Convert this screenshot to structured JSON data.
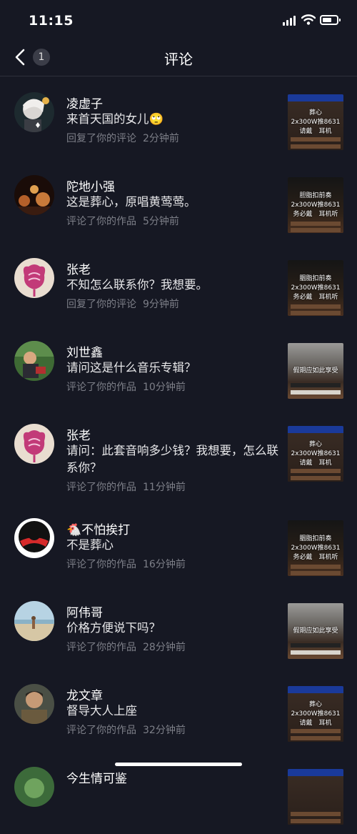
{
  "status": {
    "time": "11:15"
  },
  "nav": {
    "back_icon": "chevron-left-icon",
    "count": "1",
    "title": "评论"
  },
  "items": [
    {
      "name": "凌虚子",
      "comment": "来首天国的女儿🙄",
      "action": "回复了你的评论",
      "time": "2分钟前",
      "avatar": "anime-avatar",
      "thumb": {
        "lines": [
          "葬心",
          "2x300W推8631",
          "请戴　耳机"
        ],
        "style": "blue"
      }
    },
    {
      "name": "陀地小强",
      "comment": "这是葬心，原唱黄莺莺。",
      "action": "评论了你的作品",
      "time": "5分钟前",
      "avatar": "band-avatar",
      "thumb": {
        "lines": [
          "胆脂扣前奏",
          "2x300W推8631",
          "务必戴　耳机听"
        ],
        "style": "dark"
      }
    },
    {
      "name": "张老",
      "comment": "不知怎么联系你？我想要。",
      "action": "回复了你的评论",
      "time": "9分钟前",
      "avatar": "flower-avatar",
      "thumb": {
        "lines": [
          "胭脂扣前奏",
          "2x300W推8631",
          "务必戴　耳机听"
        ],
        "style": "dark"
      }
    },
    {
      "name": "刘世鑫",
      "comment": "请问这是什么音乐专辑？",
      "action": "评论了你的作品",
      "time": "10分钟前",
      "avatar": "child-avatar",
      "thumb": {
        "lines": [
          "假期应如此享受"
        ],
        "style": "room"
      }
    },
    {
      "name": "张老",
      "comment": "请问：此套音响多少钱？我想要，怎么联系你？",
      "action": "评论了你的作品",
      "time": "11分钟前",
      "avatar": "flower-avatar",
      "thumb": {
        "lines": [
          "葬心",
          "2x300W推8631",
          "请戴　耳机"
        ],
        "style": "blue"
      }
    },
    {
      "name": "🐔不怕挨打",
      "comment": "不是葬心",
      "action": "评论了你的作品",
      "time": "16分钟前",
      "avatar": "hero-avatar",
      "thumb": {
        "lines": [
          "胭脂扣前奏",
          "2x300W推8631",
          "务必戴　耳机听"
        ],
        "style": "dark"
      }
    },
    {
      "name": "阿伟哥",
      "comment": "价格方便说下吗？",
      "action": "评论了你的作品",
      "time": "28分钟前",
      "avatar": "beach-avatar",
      "thumb": {
        "lines": [
          "假期应如此享受"
        ],
        "style": "room"
      }
    },
    {
      "name": "龙文章",
      "comment": "督导大人上座",
      "action": "评论了你的作品",
      "time": "32分钟前",
      "avatar": "man-avatar",
      "thumb": {
        "lines": [
          "葬心",
          "2x300W推8631",
          "请戴　耳机"
        ],
        "style": "blue"
      }
    },
    {
      "name": "今生情可鉴",
      "comment": "",
      "action": "",
      "time": "",
      "avatar": "green-avatar",
      "thumb": {
        "lines": [],
        "style": "blue"
      }
    }
  ]
}
